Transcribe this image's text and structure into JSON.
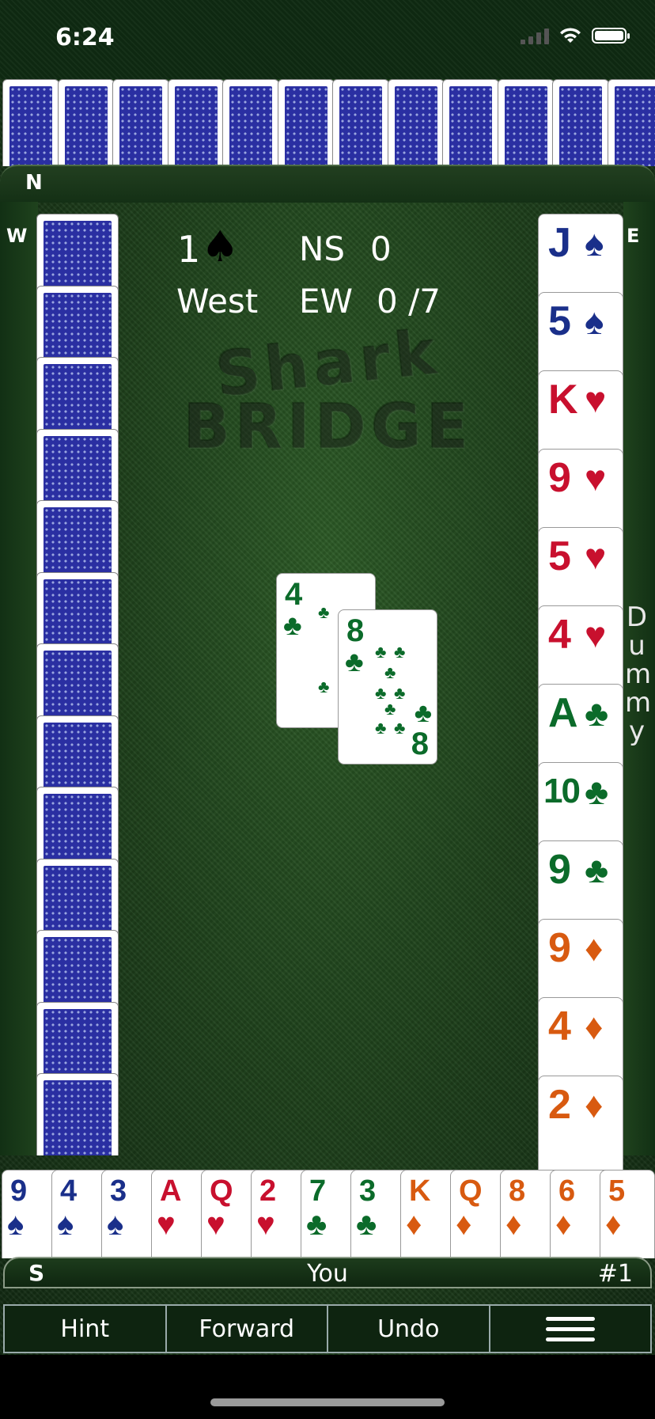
{
  "status_bar": {
    "time": "6:24"
  },
  "seats": {
    "north": "N",
    "west": "W",
    "east": "E",
    "south": "S"
  },
  "contract": {
    "level": "1",
    "suit_symbol": "♠",
    "declarer": "West",
    "ns_label": "NS",
    "ns_score": "0",
    "ew_label": "EW",
    "ew_score": "0 /7"
  },
  "logo_text": {
    "line1": "Shark",
    "line2": "BRIDGE"
  },
  "east_hand": [
    {
      "rank": "J",
      "suit": "♠",
      "color": "blue"
    },
    {
      "rank": "5",
      "suit": "♠",
      "color": "blue"
    },
    {
      "rank": "K",
      "suit": "♥",
      "color": "red"
    },
    {
      "rank": "9",
      "suit": "♥",
      "color": "red"
    },
    {
      "rank": "5",
      "suit": "♥",
      "color": "red"
    },
    {
      "rank": "4",
      "suit": "♥",
      "color": "red"
    },
    {
      "rank": "A",
      "suit": "♣",
      "color": "green"
    },
    {
      "rank": "10",
      "suit": "♣",
      "color": "green"
    },
    {
      "rank": "9",
      "suit": "♣",
      "color": "green"
    },
    {
      "rank": "9",
      "suit": "♦",
      "color": "orange"
    },
    {
      "rank": "4",
      "suit": "♦",
      "color": "orange"
    },
    {
      "rank": "2",
      "suit": "♦",
      "color": "orange"
    }
  ],
  "dummy_label": [
    "D",
    "u",
    "m",
    "m",
    "y"
  ],
  "trick": [
    {
      "rank": "4",
      "suit": "♣"
    },
    {
      "rank": "8",
      "suit": "♣"
    }
  ],
  "south_hand": [
    {
      "rank": "9",
      "suit": "♠",
      "color": "blue"
    },
    {
      "rank": "4",
      "suit": "♠",
      "color": "blue"
    },
    {
      "rank": "3",
      "suit": "♠",
      "color": "blue"
    },
    {
      "rank": "A",
      "suit": "♥",
      "color": "red"
    },
    {
      "rank": "Q",
      "suit": "♥",
      "color": "red"
    },
    {
      "rank": "2",
      "suit": "♥",
      "color": "red"
    },
    {
      "rank": "7",
      "suit": "♣",
      "color": "green"
    },
    {
      "rank": "3",
      "suit": "♣",
      "color": "green"
    },
    {
      "rank": "K",
      "suit": "♦",
      "color": "orange"
    },
    {
      "rank": "Q",
      "suit": "♦",
      "color": "orange"
    },
    {
      "rank": "8",
      "suit": "♦",
      "color": "orange"
    },
    {
      "rank": "6",
      "suit": "♦",
      "color": "orange"
    },
    {
      "rank": "5",
      "suit": "♦",
      "color": "orange"
    }
  ],
  "south_bar": {
    "seat": "S",
    "player": "You",
    "board": "#1"
  },
  "toolbar": {
    "hint": "Hint",
    "forward": "Forward",
    "undo": "Undo",
    "menu_icon": "hamburger-menu-icon"
  },
  "colors": {
    "felt": "#1d3f1a",
    "card_back": "#2a2fa2",
    "red": "#c8102e",
    "blue": "#1a2f8a",
    "green": "#0b6b2a",
    "orange": "#d85a10"
  }
}
